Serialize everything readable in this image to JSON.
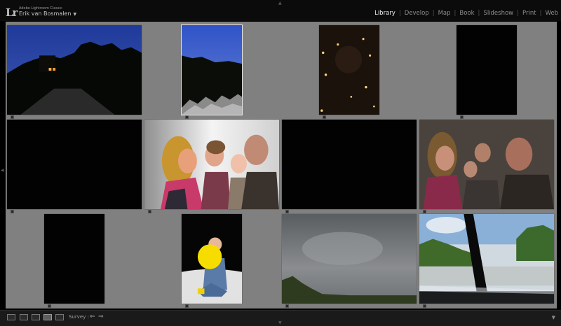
{
  "app": {
    "logo": "Lr",
    "product": "Adobe Lightroom Classic",
    "user": "Erik van Bosmalen",
    "user_arrow": "▼"
  },
  "modules": [
    {
      "label": "Library",
      "active": true
    },
    {
      "label": "Develop",
      "active": false
    },
    {
      "label": "Map",
      "active": false
    },
    {
      "label": "Book",
      "active": false
    },
    {
      "label": "Slideshow",
      "active": false
    },
    {
      "label": "Print",
      "active": false
    },
    {
      "label": "Web",
      "active": false
    }
  ],
  "grid": {
    "photos": [
      {
        "id": "photo-1",
        "kind": "dusk-house",
        "orientation": "landscape"
      },
      {
        "id": "photo-2",
        "kind": "blue-sky-rocks",
        "orientation": "portrait",
        "selected": true
      },
      {
        "id": "photo-3",
        "kind": "dark-lights",
        "orientation": "portrait"
      },
      {
        "id": "photo-4",
        "kind": "black",
        "orientation": "portrait"
      },
      {
        "id": "photo-5",
        "kind": "black",
        "orientation": "landscape"
      },
      {
        "id": "photo-6",
        "kind": "family-kiss",
        "orientation": "landscape"
      },
      {
        "id": "photo-7",
        "kind": "black",
        "orientation": "landscape"
      },
      {
        "id": "photo-8",
        "kind": "family-dark",
        "orientation": "landscape"
      },
      {
        "id": "photo-9",
        "kind": "black",
        "orientation": "portrait"
      },
      {
        "id": "photo-10",
        "kind": "baby-balloon",
        "orientation": "portrait"
      },
      {
        "id": "photo-11",
        "kind": "cloudy-sky",
        "orientation": "landscape"
      },
      {
        "id": "photo-12",
        "kind": "road-window",
        "orientation": "landscape"
      }
    ]
  },
  "toolbar": {
    "survey_label": "Survey :",
    "prev": "⇐",
    "next": "⇒",
    "menu": "▼"
  },
  "panel_arrows": {
    "top": "▲",
    "left": "◀",
    "bottom": "▼"
  }
}
